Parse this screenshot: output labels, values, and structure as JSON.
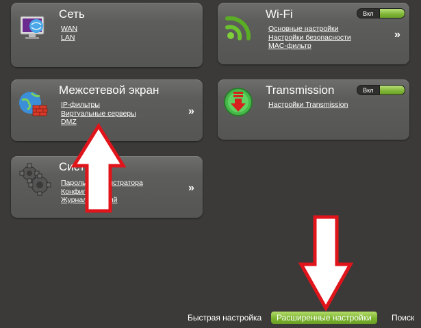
{
  "panels": {
    "network": {
      "title": "Сеть",
      "links": [
        "WAN",
        "LAN"
      ]
    },
    "wifi": {
      "title": "Wi-Fi",
      "toggle_label": "Вкл",
      "links": [
        "Основные настройки",
        "Настройки безопасности",
        "MAC-фильтр"
      ],
      "more": "»"
    },
    "firewall": {
      "title": "Межсетевой экран",
      "links": [
        "IP-фильтры",
        "Виртуальные серверы",
        "DMZ"
      ],
      "more": "»"
    },
    "transmission": {
      "title": "Transmission",
      "toggle_label": "Вкл",
      "links": [
        "Настройки Transmission"
      ]
    },
    "system": {
      "title": "Система",
      "links": [
        "Пароль администратора",
        "Конфигурация",
        "Журнал событий"
      ],
      "more": "»"
    }
  },
  "bottom_nav": {
    "quick": "Быстрая настройка",
    "advanced": "Расширенные настройки",
    "search": "Поиск"
  },
  "colors": {
    "background": "#3b3a38",
    "panel": "#5f5f5d",
    "toggle_on": "#7fb536",
    "annotation_arrow": "#e0141b"
  },
  "icons": {
    "network": "monitor-globe-icon",
    "wifi": "wifi-icon",
    "firewall": "firewall-globe-icon",
    "transmission": "download-arrow-icon",
    "system": "gears-icon"
  }
}
